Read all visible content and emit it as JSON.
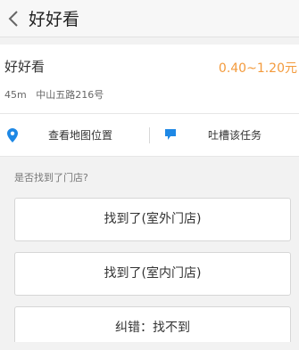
{
  "nav": {
    "back_icon": "chevron-left-icon",
    "title": "好好看"
  },
  "shop": {
    "name": "好好看",
    "price_range": "0.40~1.20元",
    "distance": "45m",
    "address": "中山五路216号"
  },
  "actions": [
    {
      "icon": "map-pin-icon",
      "label": "查看地图位置"
    },
    {
      "icon": "comment-icon",
      "label": "吐槽该任务"
    }
  ],
  "question": {
    "text": "是否找到了门店?"
  },
  "answers": [
    {
      "label": "找到了(室外门店)"
    },
    {
      "label": "找到了(室内门店)"
    },
    {
      "label": "纠错：找不到"
    }
  ],
  "colors": {
    "accent": "#f39a3c",
    "icon_blue": "#1e88e5"
  }
}
